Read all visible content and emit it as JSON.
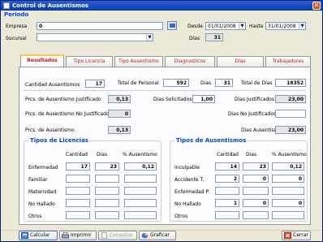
{
  "window": {
    "title": "Control de Ausentismos"
  },
  "periodo": {
    "label": "Periodo",
    "empresa_label": "Empresa",
    "empresa_value": "0",
    "sucursal_label": "Sucursal",
    "sucursal_value": "",
    "desde_label": "Desde",
    "desde_value": "01/01/2008",
    "hasta_label": "Hasta",
    "hasta_value": "31/01/2008",
    "dias_label": "Días",
    "dias_value": "31"
  },
  "tabs": [
    "Resultados",
    "Tipo Licencia",
    "Tipo Ausentismo",
    "Diagnosticos",
    "Días",
    "Trabajadores"
  ],
  "resultados": {
    "cantidad_ausentismos_label": "Cantidad Ausentismos",
    "cantidad_ausentismos": "17",
    "total_personal_label": "Total de Personal",
    "total_personal": "592",
    "dias_label": "Dias",
    "dias": "31",
    "total_dias_label": "Total de Días",
    "total_dias": "18352",
    "prc_justificado_label": "Prcs. de Ausentismo Justificado",
    "prc_justificado": "0,13",
    "dias_solicitados_label": "Dias Solicitados",
    "dias_solicitados": "1,00",
    "dias_justificados_label": "Dias Justificados",
    "dias_justificados": "23,00",
    "prc_no_justificado_label": "Prcs. de Ausentismo No Justificado",
    "prc_no_justificado": "0",
    "dias_no_justificados_label": "Dias No Justificados",
    "dias_no_justificados": "",
    "prc_ausentismo_label": "Prcs. de Ausentismo",
    "prc_ausentismo": "0,13",
    "dias_ausentismo_label": "Dias Ausentismo",
    "dias_ausentismo": "23,00"
  },
  "licencias": {
    "title": "Tipos de Licencias",
    "headers": [
      "Cantidad",
      "Dias",
      "% Ausentismo"
    ],
    "rows": [
      {
        "label": "Enfermedad",
        "values": [
          "17",
          "23",
          "0,12"
        ]
      },
      {
        "label": "Familiar",
        "values": [
          "",
          "",
          ""
        ]
      },
      {
        "label": "Maternidad",
        "values": [
          "",
          "",
          ""
        ]
      },
      {
        "label": "No Hallado",
        "values": [
          "",
          "",
          ""
        ]
      },
      {
        "label": "Otros",
        "values": [
          "",
          "",
          ""
        ]
      }
    ]
  },
  "ausentismos": {
    "title": "Tipos de Ausentismos",
    "headers": [
      "Cantidad",
      "Dias",
      "% Ausentismo"
    ],
    "rows": [
      {
        "label": "Inculpable",
        "values": [
          "14",
          "23",
          "0,12"
        ]
      },
      {
        "label": "Accidente T.",
        "values": [
          "2",
          "0",
          "0"
        ]
      },
      {
        "label": "Enfermedad P.",
        "values": [
          "",
          "",
          ""
        ]
      },
      {
        "label": "No Hallado",
        "values": [
          "1",
          "0",
          "0"
        ]
      },
      {
        "label": "Otros",
        "values": [
          "",
          "",
          ""
        ]
      }
    ]
  },
  "buttons": {
    "calcular": "Calcular",
    "imprimir": "Imprimir",
    "consultar": "Consultar",
    "graficar": "Graficar",
    "cerrar": "Cerrar"
  },
  "colors": {
    "title_bar": "#0a3ca8",
    "section_title": "#0046d5",
    "tab_text": "#b22222"
  }
}
